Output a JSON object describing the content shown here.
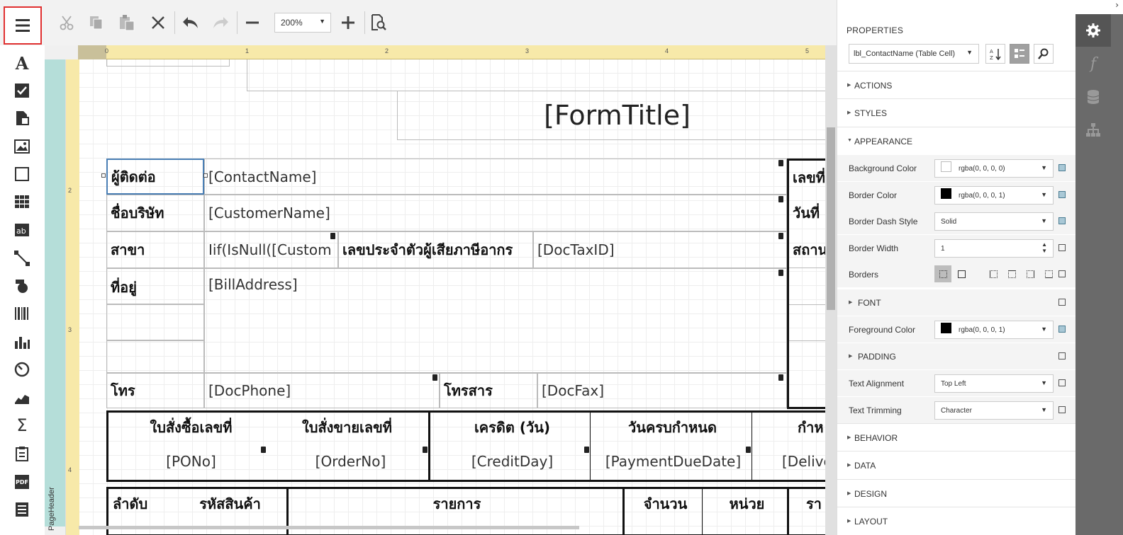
{
  "toolbar": {
    "zoom_value": "200%",
    "buttons": [
      "cut",
      "copy",
      "paste",
      "delete",
      "undo",
      "redo",
      "zoom-out",
      "zoom-in",
      "preview"
    ]
  },
  "toolbox": {
    "tools": [
      "label",
      "checkbox",
      "rich-text",
      "picture",
      "panel",
      "table",
      "character-comb",
      "line",
      "shape",
      "barcode",
      "chart",
      "gauge",
      "sparkline",
      "summary",
      "subreport",
      "pdf-content",
      "table-of-contents"
    ]
  },
  "surface": {
    "band_name": "PageHeader",
    "ruler_h": [
      "0",
      "1",
      "2",
      "3",
      "4",
      "5"
    ],
    "ruler_v": [
      "2",
      "3",
      "4"
    ]
  },
  "report": {
    "form_title": "[FormTitle]",
    "contact_label": "ผู้ติดต่อ",
    "contact_value": "[ContactName]",
    "company_label": "ชื่อบริษัท",
    "company_value": "[CustomerName]",
    "branch_label": "สาขา",
    "branch_value": "Iif(IsNull([Custom",
    "taxid_label": "เลขประจำตัวผู้เสียภาษีอากร",
    "taxid_value": "[DocTaxID]",
    "address_label": "ที่อยู่",
    "address_value": "[BillAddress]",
    "phone_label": "โทร",
    "phone_value": "[DocPhone]",
    "fax_label": "โทรสาร",
    "fax_value": "[DocFax]",
    "right_labels": [
      "เลขที่",
      "วันที่",
      "สถาน"
    ],
    "summary_headers": [
      "ใบสั่งซื้อเลขที่",
      "ใบสั่งขายเลขที่",
      "เครดิต (วัน)",
      "วันครบกำหนด",
      "กำห"
    ],
    "summary_values": [
      "[PONo]",
      "[OrderNo]",
      "[CreditDay]",
      "[PaymentDueDate]",
      "[Delive"
    ],
    "detail_headers": [
      "ลำดับ",
      "รหัสสินค้า",
      "รายการ",
      "จำนวน",
      "หน่วย",
      "รา"
    ]
  },
  "properties": {
    "title": "PROPERTIES",
    "selected_component": "lbl_ContactName (Table Cell)",
    "sections_top": [
      "ACTIONS",
      "STYLES",
      "APPEARANCE"
    ],
    "rows": [
      {
        "name": "Background Color",
        "value": "rgba(0, 0, 0, 0)",
        "swatch": "#ffffff",
        "checked": true
      },
      {
        "name": "Border Color",
        "value": "rgba(0, 0, 0, 1)",
        "swatch": "#000000",
        "checked": true
      },
      {
        "name": "Border Dash Style",
        "value": "Solid",
        "checked": true
      },
      {
        "name": "Border Width",
        "value": "1",
        "checked": false
      },
      {
        "name": "Borders",
        "value": "",
        "checked": false
      },
      {
        "name": "FONT",
        "value": "",
        "checked": false
      },
      {
        "name": "Foreground Color",
        "value": "rgba(0, 0, 0, 1)",
        "swatch": "#000000",
        "checked": true
      },
      {
        "name": "PADDING",
        "value": "",
        "checked": false
      },
      {
        "name": "Text Alignment",
        "value": "Top Left",
        "checked": false
      },
      {
        "name": "Text Trimming",
        "value": "Character",
        "checked": false
      }
    ],
    "sections_bottom": [
      "BEHAVIOR",
      "DATA",
      "DESIGN",
      "LAYOUT"
    ]
  },
  "tabs": [
    "properties",
    "expressions",
    "field-list",
    "report-explorer"
  ]
}
